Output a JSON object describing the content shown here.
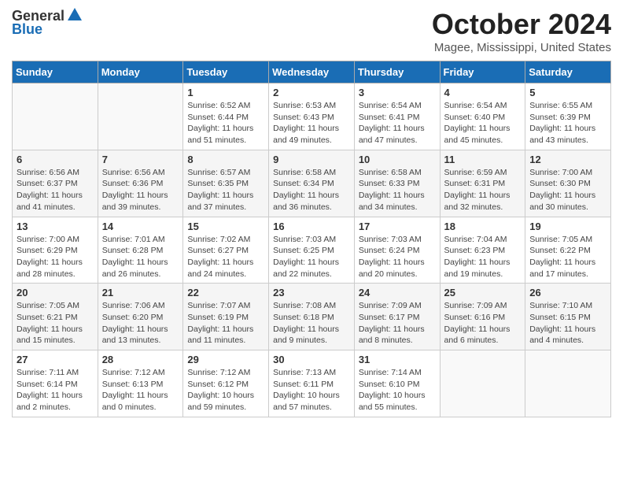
{
  "logo": {
    "general": "General",
    "blue": "Blue"
  },
  "title": "October 2024",
  "location": "Magee, Mississippi, United States",
  "days_of_week": [
    "Sunday",
    "Monday",
    "Tuesday",
    "Wednesday",
    "Thursday",
    "Friday",
    "Saturday"
  ],
  "weeks": [
    [
      {
        "day": "",
        "info": ""
      },
      {
        "day": "",
        "info": ""
      },
      {
        "day": "1",
        "info": "Sunrise: 6:52 AM\nSunset: 6:44 PM\nDaylight: 11 hours and 51 minutes."
      },
      {
        "day": "2",
        "info": "Sunrise: 6:53 AM\nSunset: 6:43 PM\nDaylight: 11 hours and 49 minutes."
      },
      {
        "day": "3",
        "info": "Sunrise: 6:54 AM\nSunset: 6:41 PM\nDaylight: 11 hours and 47 minutes."
      },
      {
        "day": "4",
        "info": "Sunrise: 6:54 AM\nSunset: 6:40 PM\nDaylight: 11 hours and 45 minutes."
      },
      {
        "day": "5",
        "info": "Sunrise: 6:55 AM\nSunset: 6:39 PM\nDaylight: 11 hours and 43 minutes."
      }
    ],
    [
      {
        "day": "6",
        "info": "Sunrise: 6:56 AM\nSunset: 6:37 PM\nDaylight: 11 hours and 41 minutes."
      },
      {
        "day": "7",
        "info": "Sunrise: 6:56 AM\nSunset: 6:36 PM\nDaylight: 11 hours and 39 minutes."
      },
      {
        "day": "8",
        "info": "Sunrise: 6:57 AM\nSunset: 6:35 PM\nDaylight: 11 hours and 37 minutes."
      },
      {
        "day": "9",
        "info": "Sunrise: 6:58 AM\nSunset: 6:34 PM\nDaylight: 11 hours and 36 minutes."
      },
      {
        "day": "10",
        "info": "Sunrise: 6:58 AM\nSunset: 6:33 PM\nDaylight: 11 hours and 34 minutes."
      },
      {
        "day": "11",
        "info": "Sunrise: 6:59 AM\nSunset: 6:31 PM\nDaylight: 11 hours and 32 minutes."
      },
      {
        "day": "12",
        "info": "Sunrise: 7:00 AM\nSunset: 6:30 PM\nDaylight: 11 hours and 30 minutes."
      }
    ],
    [
      {
        "day": "13",
        "info": "Sunrise: 7:00 AM\nSunset: 6:29 PM\nDaylight: 11 hours and 28 minutes."
      },
      {
        "day": "14",
        "info": "Sunrise: 7:01 AM\nSunset: 6:28 PM\nDaylight: 11 hours and 26 minutes."
      },
      {
        "day": "15",
        "info": "Sunrise: 7:02 AM\nSunset: 6:27 PM\nDaylight: 11 hours and 24 minutes."
      },
      {
        "day": "16",
        "info": "Sunrise: 7:03 AM\nSunset: 6:25 PM\nDaylight: 11 hours and 22 minutes."
      },
      {
        "day": "17",
        "info": "Sunrise: 7:03 AM\nSunset: 6:24 PM\nDaylight: 11 hours and 20 minutes."
      },
      {
        "day": "18",
        "info": "Sunrise: 7:04 AM\nSunset: 6:23 PM\nDaylight: 11 hours and 19 minutes."
      },
      {
        "day": "19",
        "info": "Sunrise: 7:05 AM\nSunset: 6:22 PM\nDaylight: 11 hours and 17 minutes."
      }
    ],
    [
      {
        "day": "20",
        "info": "Sunrise: 7:05 AM\nSunset: 6:21 PM\nDaylight: 11 hours and 15 minutes."
      },
      {
        "day": "21",
        "info": "Sunrise: 7:06 AM\nSunset: 6:20 PM\nDaylight: 11 hours and 13 minutes."
      },
      {
        "day": "22",
        "info": "Sunrise: 7:07 AM\nSunset: 6:19 PM\nDaylight: 11 hours and 11 minutes."
      },
      {
        "day": "23",
        "info": "Sunrise: 7:08 AM\nSunset: 6:18 PM\nDaylight: 11 hours and 9 minutes."
      },
      {
        "day": "24",
        "info": "Sunrise: 7:09 AM\nSunset: 6:17 PM\nDaylight: 11 hours and 8 minutes."
      },
      {
        "day": "25",
        "info": "Sunrise: 7:09 AM\nSunset: 6:16 PM\nDaylight: 11 hours and 6 minutes."
      },
      {
        "day": "26",
        "info": "Sunrise: 7:10 AM\nSunset: 6:15 PM\nDaylight: 11 hours and 4 minutes."
      }
    ],
    [
      {
        "day": "27",
        "info": "Sunrise: 7:11 AM\nSunset: 6:14 PM\nDaylight: 11 hours and 2 minutes."
      },
      {
        "day": "28",
        "info": "Sunrise: 7:12 AM\nSunset: 6:13 PM\nDaylight: 11 hours and 0 minutes."
      },
      {
        "day": "29",
        "info": "Sunrise: 7:12 AM\nSunset: 6:12 PM\nDaylight: 10 hours and 59 minutes."
      },
      {
        "day": "30",
        "info": "Sunrise: 7:13 AM\nSunset: 6:11 PM\nDaylight: 10 hours and 57 minutes."
      },
      {
        "day": "31",
        "info": "Sunrise: 7:14 AM\nSunset: 6:10 PM\nDaylight: 10 hours and 55 minutes."
      },
      {
        "day": "",
        "info": ""
      },
      {
        "day": "",
        "info": ""
      }
    ]
  ]
}
